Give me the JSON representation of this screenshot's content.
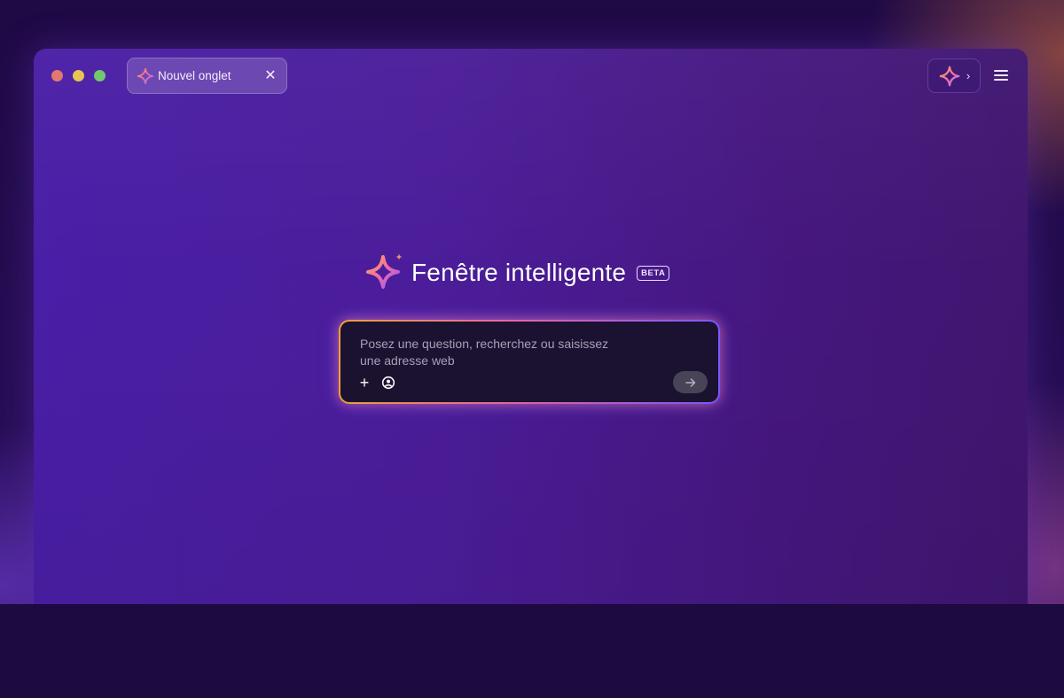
{
  "window": {
    "traffic_lights": [
      "close",
      "minimize",
      "maximize"
    ]
  },
  "tab": {
    "label": "Nouvel onglet",
    "close_symbol": "✕",
    "icon": "sparkle-icon"
  },
  "toolbar": {
    "ai_button_icon": "sparkle-icon",
    "ai_button_chevron": "›",
    "menu_icon": "hamburger-menu-icon"
  },
  "hero": {
    "title": "Fenêtre intelligente",
    "badge": "BETA"
  },
  "prompt": {
    "placeholder": "Posez une question, recherchez ou saisissez une adresse web",
    "value": "",
    "add_symbol": "+",
    "send_icon": "arrow-right-icon"
  },
  "colors": {
    "window": "#4a1ea6",
    "prompt_bg": "#1a1230",
    "glow_start": "#f2a23b",
    "glow_mid": "#e766a7",
    "glow_end": "#7c58ff"
  }
}
